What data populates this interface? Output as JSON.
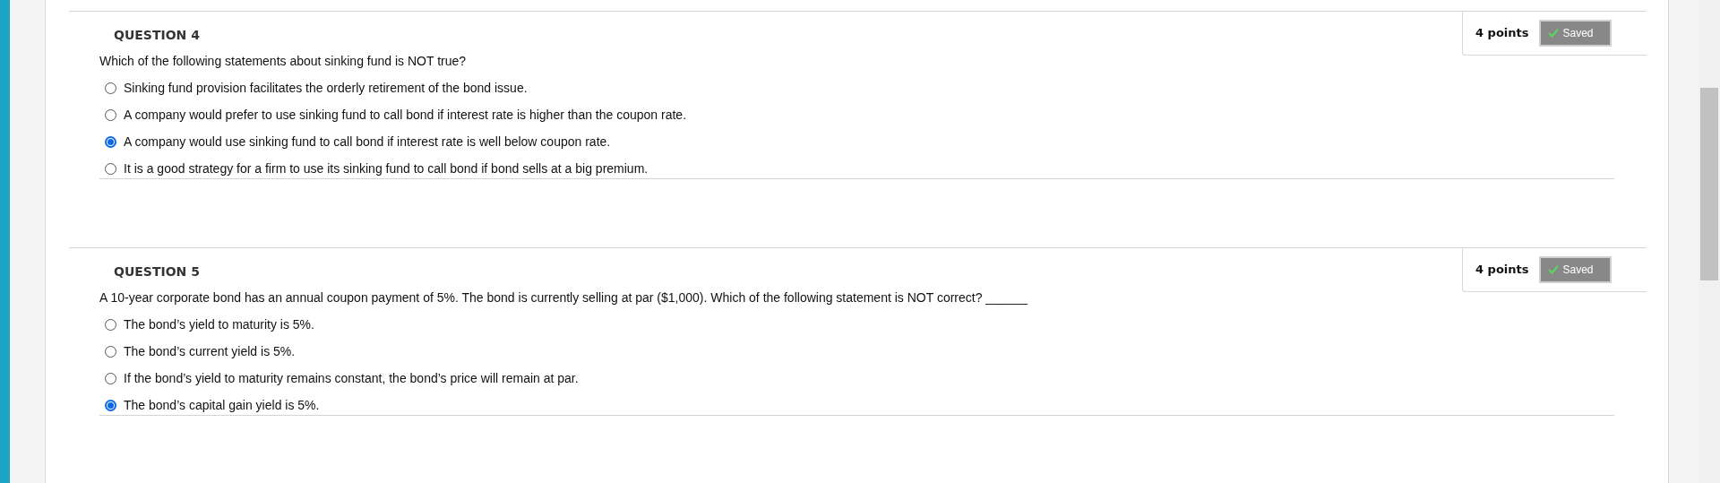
{
  "questions": [
    {
      "title": "QUESTION 4",
      "points": "4 points",
      "status": "Saved",
      "prompt": "Which of the following statements about sinking fund is NOT true?",
      "options": [
        {
          "label": "Sinking fund provision facilitates the orderly retirement of the bond issue.",
          "selected": false
        },
        {
          "label": "A company would prefer to use sinking fund to call bond if interest rate is higher than the coupon rate.",
          "selected": false
        },
        {
          "label": "A company would use sinking fund to call bond if interest rate is well below coupon rate.",
          "selected": true
        },
        {
          "label": "It is a good strategy for a firm to use its sinking fund to call bond if bond sells at a big premium.",
          "selected": false
        }
      ]
    },
    {
      "title": "QUESTION 5",
      "points": "4 points",
      "status": "Saved",
      "prompt": "A 10-year corporate bond has an annual coupon payment of 5%. The bond is currently selling at par ($1,000). Which of the following statement is NOT correct? ______",
      "options": [
        {
          "label": "The bond’s yield to maturity is 5%.",
          "selected": false
        },
        {
          "label": "The bond’s current yield is 5%.",
          "selected": false
        },
        {
          "label": "If the bond’s yield to maturity remains constant, the bond’s price will remain at par.",
          "selected": false
        },
        {
          "label": "The bond’s capital gain yield is 5%.",
          "selected": true
        }
      ]
    }
  ]
}
